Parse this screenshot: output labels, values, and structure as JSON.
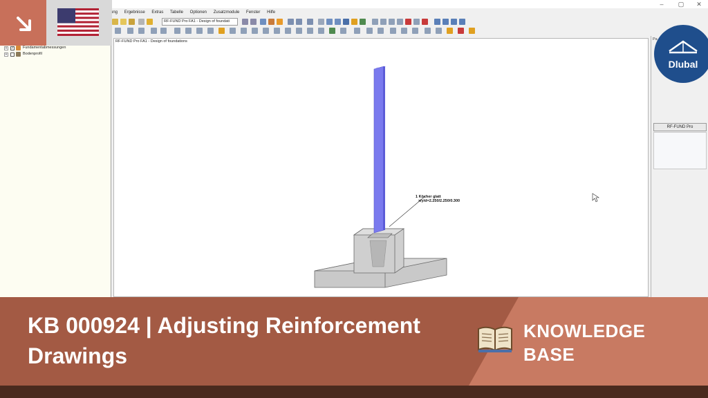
{
  "window": {
    "controls": [
      "–",
      "▢",
      "✕"
    ]
  },
  "menu": [
    "ung",
    "Ergebnisse",
    "Extras",
    "Tabelle",
    "Optionen",
    "Zusatzmodule",
    "Fenster",
    "Hilfe"
  ],
  "toolbar": {
    "module_select": "RF-FUND Pro FA1 - Design of foundati"
  },
  "navigator": {
    "items": [
      {
        "label": "Fundamentabmessungen",
        "checked": true,
        "icon": "dimensions-icon"
      },
      {
        "label": "Bodenprofil",
        "checked": false,
        "icon": "soil-icon"
      }
    ]
  },
  "view": {
    "caption": "RF-FUND Pro FA1 - Design of foundations",
    "annotation_line1": "1 Köcher glatt",
    "annotation_line2": "x/y/d=2.250/2.250/0.300"
  },
  "panel": {
    "tab_label": "Pa",
    "button_label": "RF-FUND Pro"
  },
  "badge": {
    "icon": "arrow-down-right-icon",
    "flag": "us-flag-icon"
  },
  "logo": {
    "text": "Dlubal"
  },
  "banner": {
    "title": "KB 000924 | Adjusting Reinforcement Drawings",
    "kb_label": "KNOWLEDGE BASE",
    "icon": "book-icon"
  },
  "colors": {
    "banner_dark": "#a35a44",
    "banner_light": "#c87a62",
    "brand_blue": "#1f4e8c",
    "member_blue": "#7a7aee"
  }
}
